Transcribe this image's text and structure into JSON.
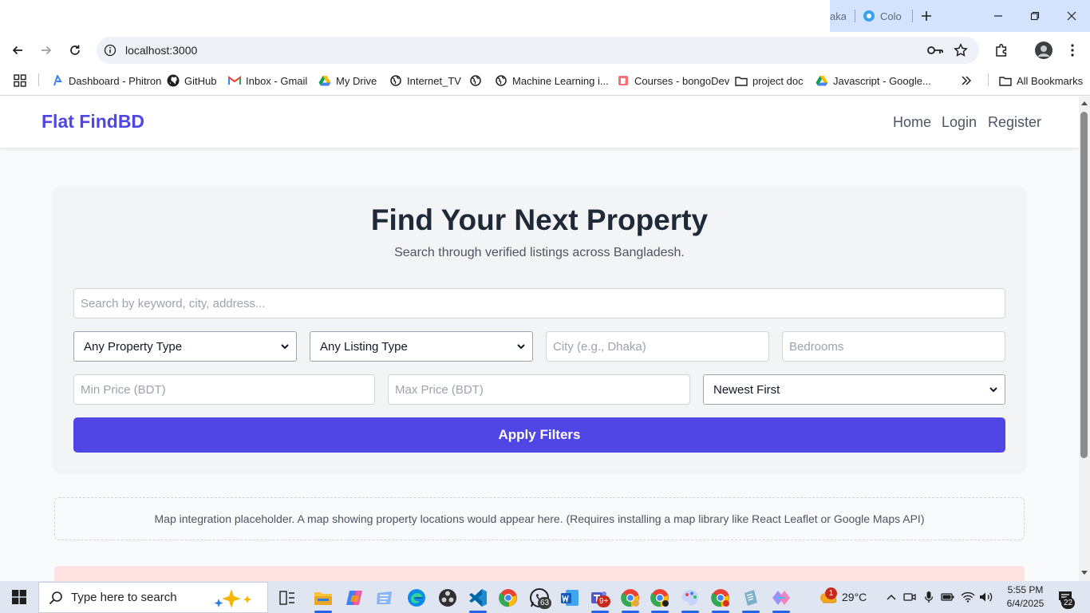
{
  "browser": {
    "tabs": [
      {
        "label": "aka"
      },
      {
        "label": "Colo"
      }
    ],
    "url": "localhost:3000",
    "bookmarks": [
      {
        "label": "Dashboard - Phitron",
        "icon": "phitron-icon"
      },
      {
        "label": "GitHub",
        "icon": "github-icon"
      },
      {
        "label": "Inbox  - Gmail",
        "icon": "gmail-icon"
      },
      {
        "label": "My Drive",
        "icon": "drive-icon"
      },
      {
        "label": "Internet_TV",
        "icon": "globe-icon"
      },
      {
        "label": "",
        "icon": "globe-icon"
      },
      {
        "label": "Machine Learning i...",
        "icon": "globe-icon"
      },
      {
        "label": "Courses - bongoDev",
        "icon": "bongodev-icon"
      },
      {
        "label": "project doc",
        "icon": "folder-icon"
      },
      {
        "label": "Javascript - Google...",
        "icon": "drive-icon"
      }
    ],
    "all_bookmarks": "All Bookmarks"
  },
  "site": {
    "brand": "Flat FindBD",
    "nav": {
      "home": "Home",
      "login": "Login",
      "register": "Register"
    }
  },
  "hero": {
    "title": "Find Your Next Property",
    "subtitle": "Search through verified listings across Bangladesh."
  },
  "filters": {
    "search_placeholder": "Search by keyword, city, address...",
    "property_type": "Any Property Type",
    "listing_type": "Any Listing Type",
    "city_placeholder": "City (e.g., Dhaka)",
    "bedrooms_placeholder": "Bedrooms",
    "min_price_placeholder": "Min Price (BDT)",
    "max_price_placeholder": "Max Price (BDT)",
    "sort": "Newest First",
    "apply": "Apply Filters"
  },
  "map": {
    "placeholder": "Map integration placeholder. A map showing property locations would appear here. (Requires installing a map library like React Leaflet or Google Maps API)"
  },
  "taskbar": {
    "search_text": "Type here to search",
    "whatsapp_badge": "63",
    "teams_badge": "9+",
    "weather_badge": "1",
    "temperature": "29°C",
    "time": "5:55 PM",
    "date": "6/4/2025",
    "notifications": "22"
  },
  "colors": {
    "accent": "#4f46e5",
    "heading": "#1f2937",
    "tabstrip": "#d3e3fd"
  }
}
